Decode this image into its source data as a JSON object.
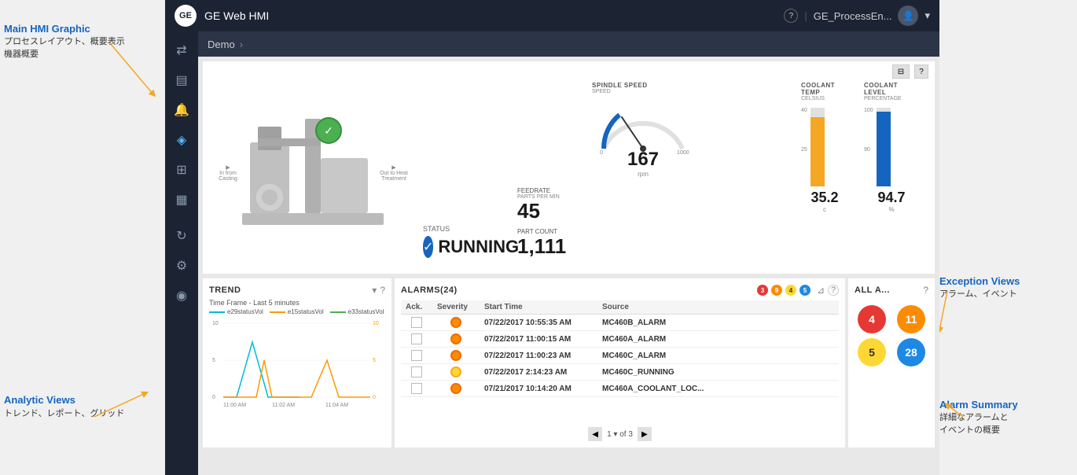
{
  "app": {
    "title": "GE Web HMI",
    "logo": "GE",
    "user": "GE_ProcessEn...",
    "help_icon": "?",
    "breadcrumb": "Demo"
  },
  "sidebar": {
    "icons": [
      {
        "name": "share-icon",
        "symbol": "⇄",
        "active": false
      },
      {
        "name": "layers-icon",
        "symbol": "▤",
        "active": false
      },
      {
        "name": "bell-icon",
        "symbol": "🔔",
        "active": false
      },
      {
        "name": "chart-icon",
        "symbol": "📈",
        "active": true
      },
      {
        "name": "grid-icon",
        "symbol": "⊞",
        "active": false
      },
      {
        "name": "image-icon",
        "symbol": "🖼",
        "active": false
      },
      {
        "name": "sync-icon",
        "symbol": "↻",
        "active": false
      },
      {
        "name": "settings-icon",
        "symbol": "⚙",
        "active": false
      },
      {
        "name": "user-icon",
        "symbol": "👤",
        "active": false
      }
    ]
  },
  "hmi": {
    "spindle_speed": {
      "label": "SPINDLE SPEED",
      "sublabel": "SPEED",
      "value": "167",
      "unit": "rpm",
      "min": 0,
      "max": 1000,
      "current": 167
    },
    "coolant_temp": {
      "label": "COOLANT TEMP",
      "sublabel": "CELSIUS",
      "value": "35.2",
      "unit": "c",
      "min": 0,
      "max": 40,
      "scale_labels": [
        "40",
        "25",
        ""
      ],
      "fill_pct": 88
    },
    "coolant_level": {
      "label": "COOLANT LEVEL",
      "sublabel": "PERCENTAGE",
      "value": "94.7",
      "unit": "%",
      "min": 0,
      "max": 100,
      "scale_labels": [
        "100",
        "90",
        ""
      ],
      "fill_pct": 95
    },
    "feedrate": {
      "label": "FEEDRATE",
      "sublabel": "PARTS PER MIN",
      "value": "45"
    },
    "part_count": {
      "label": "PART COUNT",
      "value": "1,111"
    },
    "status": {
      "label": "STATUS",
      "value": "RUNNING"
    },
    "flow_in_label": "In from Casting",
    "flow_out_label": "Out to Heat Treatment"
  },
  "trend": {
    "title": "TREND",
    "timeframe": "Time Frame - Last 5 minutes",
    "legend": [
      {
        "label": "e29statusVol",
        "color": "#00bcd4"
      },
      {
        "label": "e15statusVol",
        "color": "#ff9800"
      },
      {
        "label": "e33statusVol",
        "color": "#4caf50"
      }
    ],
    "x_labels": [
      "11:00 AM",
      "11:02 AM",
      "11:04 AM"
    ],
    "y_left_labels": [
      "10",
      "5",
      "0"
    ],
    "y_right_labels": [
      "10",
      "5",
      "0"
    ]
  },
  "alarms": {
    "title": "ALARMS",
    "count": 24,
    "badges": [
      {
        "color": "red",
        "count": 3
      },
      {
        "color": "orange",
        "count": 9
      },
      {
        "color": "yellow",
        "count": 4
      },
      {
        "color": "blue",
        "count": 5
      }
    ],
    "columns": [
      "Ack.",
      "Severity",
      "Start Time",
      "Source"
    ],
    "rows": [
      {
        "ack": false,
        "severity": "orange",
        "time": "07/22/2017 10:55:35 AM",
        "source": "MC460B_ALARM"
      },
      {
        "ack": false,
        "severity": "orange",
        "time": "07/22/2017 11:00:15 AM",
        "source": "MC460A_ALARM"
      },
      {
        "ack": false,
        "severity": "orange",
        "time": "07/22/2017 11:00:23 AM",
        "source": "MC460C_ALARM"
      },
      {
        "ack": false,
        "severity": "yellow",
        "time": "07/22/2017 2:14:23 AM",
        "source": "MC460C_RUNNING"
      },
      {
        "ack": false,
        "severity": "orange",
        "time": "07/21/2017 10:14:20 AM",
        "source": "MC460A_COOLANT_LOC..."
      }
    ],
    "page_current": 1,
    "page_total": 3
  },
  "all_alarms": {
    "title": "ALL A...",
    "cells": [
      {
        "color": "red",
        "count": "4"
      },
      {
        "color": "orange",
        "count": "11"
      },
      {
        "color": "yellow",
        "count": "5"
      },
      {
        "color": "blue",
        "count": "28"
      }
    ]
  },
  "annotations": {
    "main_hmi": {
      "title": "Main HMI Graphic",
      "subtitle": "プロセスレイアウト、概要表示\n機器概要"
    },
    "analytic_views": {
      "title": "Analytic Views",
      "subtitle": "トレンド、レポート、グリッド"
    },
    "exception_views": {
      "title": "Exception Views",
      "subtitle": "アラーム、イベント"
    },
    "alarm_summary": {
      "title": "Alarm Summary",
      "subtitle": "詳細なアラームと\nイベントの概要"
    }
  }
}
